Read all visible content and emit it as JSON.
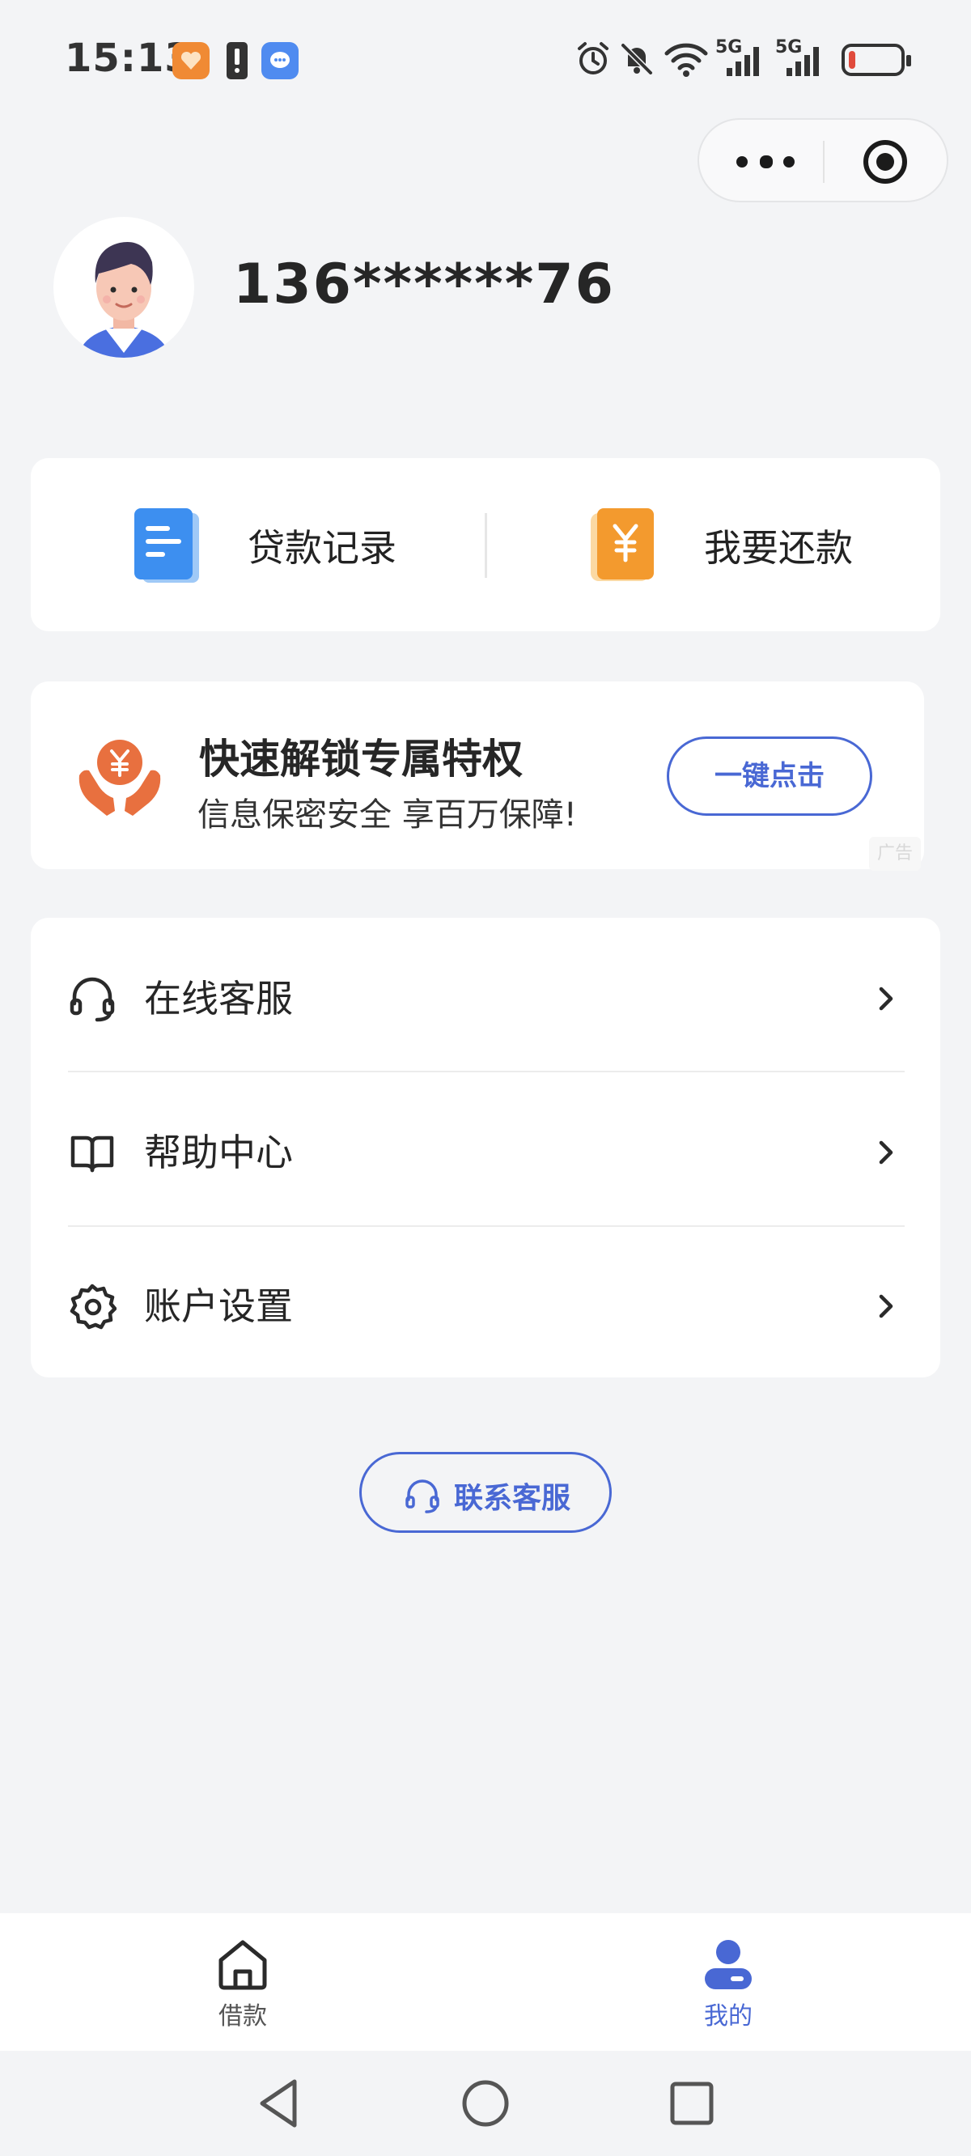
{
  "status_bar": {
    "time": "15:13",
    "signal_1": "5G",
    "signal_2": "5G",
    "battery_level": 0.12,
    "icons": [
      "alarm-icon",
      "mute-bell-icon",
      "wifi-icon",
      "signal-icon",
      "signal-icon",
      "battery-icon"
    ]
  },
  "profile": {
    "phone": "136******76"
  },
  "quick_actions": [
    {
      "label": "贷款记录",
      "icon": "document-icon"
    },
    {
      "label": "我要还款",
      "icon": "yuan-wallet-icon"
    }
  ],
  "promo": {
    "title": "快速解锁专属特权",
    "subtitle": "信息保密安全 享百万保障!",
    "button": "一键点击",
    "ad_tag": "广告",
    "icon": "hands-yuan-icon"
  },
  "menu": [
    {
      "label": "在线客服",
      "icon": "headset-icon"
    },
    {
      "label": "帮助中心",
      "icon": "book-icon"
    },
    {
      "label": "账户设置",
      "icon": "gear-icon"
    }
  ],
  "contact": {
    "label": "联系客服"
  },
  "tabs": [
    {
      "label": "借款",
      "icon": "home-icon",
      "active": false
    },
    {
      "label": "我的",
      "icon": "user-icon",
      "active": true
    }
  ],
  "colors": {
    "accent": "#4968d4",
    "background": "#f3f4f6",
    "promo_orange": "#e8703f"
  }
}
